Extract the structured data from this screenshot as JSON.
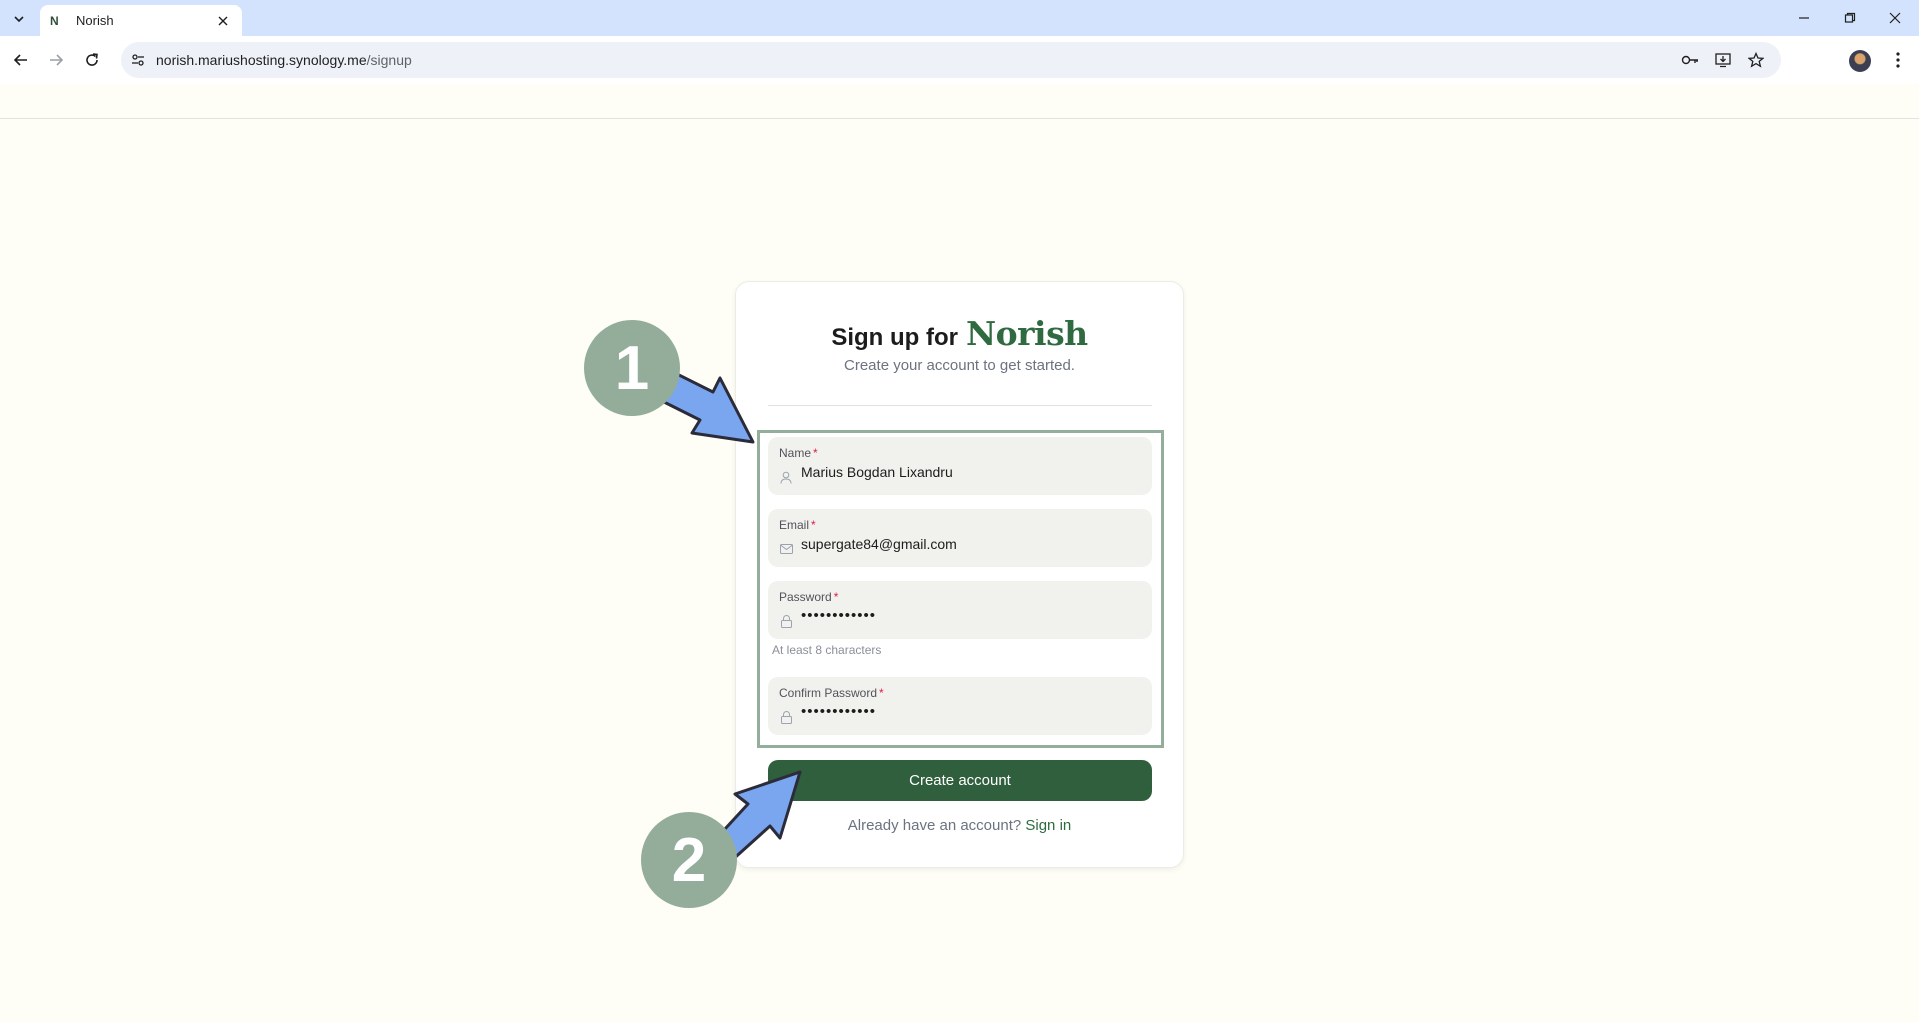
{
  "browser": {
    "tab_title": "Norish",
    "tab_favicon": "N",
    "url_host": "norish.mariushosting.synology.me",
    "url_path": "/signup",
    "icons": [
      "tab-search-icon",
      "close-icon",
      "minimize-icon",
      "restore-icon",
      "back-icon",
      "forward-icon",
      "reload-icon",
      "site-info-icon",
      "password-key-icon",
      "install-app-icon",
      "bookmark-star-icon",
      "profile-avatar",
      "more-menu-icon"
    ]
  },
  "signup": {
    "heading": "Sign up for",
    "brand": "Norish",
    "subtitle": "Create your account to get started.",
    "fields": [
      {
        "label": "Name",
        "required": "*",
        "value": "Marius Bogdan Lixandru",
        "icon": "user-icon"
      },
      {
        "label": "Email",
        "required": "*",
        "value": "supergate84@gmail.com",
        "icon": "mail-icon"
      },
      {
        "label": "Password",
        "required": "*",
        "value": "••••••••••••",
        "icon": "lock-icon",
        "hint": "At least 8 characters"
      },
      {
        "label": "Confirm Password",
        "required": "*",
        "value": "••••••••••••",
        "icon": "lock-icon"
      }
    ],
    "submit_label": "Create account",
    "signin_prompt": "Already have an account?",
    "signin_link": "Sign in"
  },
  "annotations": {
    "step1": "1",
    "step2": "2"
  },
  "colors": {
    "page_bg": "#fefef6",
    "brand_green": "#2f6a40",
    "button_green": "#2f5f3c",
    "badge_green": "#94ad9b",
    "arrow_blue": "#7aa6f0"
  }
}
